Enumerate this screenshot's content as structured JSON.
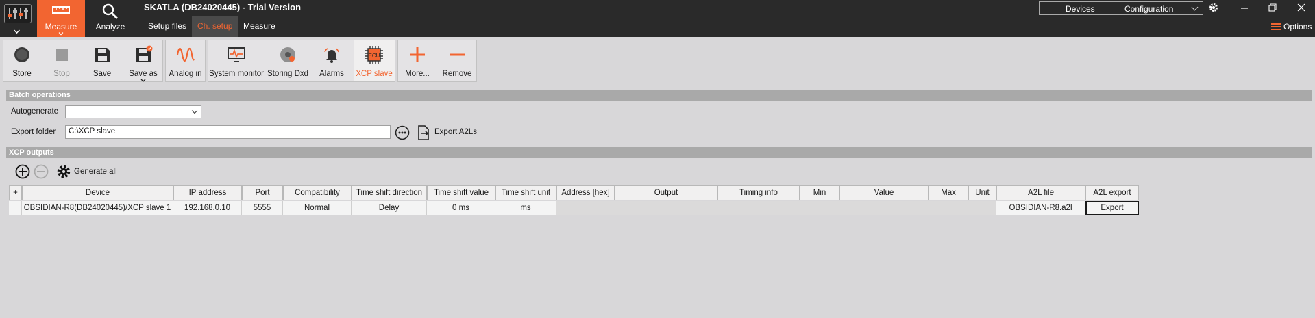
{
  "window": {
    "title": "SKATLA (DB24020445) - Trial Version"
  },
  "top_tabs": {
    "measure": "Measure",
    "analyze": "Analyze"
  },
  "sub_tabs": [
    "Setup files",
    "Ch. setup",
    "Measure"
  ],
  "devices_box": {
    "devices": "Devices",
    "configuration": "Configuration"
  },
  "options_label": "Options",
  "ribbon": {
    "store": "Store",
    "stop": "Stop",
    "save": "Save",
    "save_as": "Save as",
    "analog_in": "Analog in",
    "system_monitor": "System monitor",
    "storing_dxd": "Storing Dxd",
    "alarms": "Alarms",
    "xcp_slave": "XCP slave",
    "more": "More...",
    "remove": "Remove",
    "ecu_badge": "ECU"
  },
  "batch": {
    "header": "Batch operations",
    "autogenerate_label": "Autogenerate",
    "autogenerate_value": "",
    "export_folder_label": "Export folder",
    "export_folder_value": "C:\\XCP slave",
    "export_a2ls": "Export A2Ls"
  },
  "outputs": {
    "header": "XCP outputs",
    "generate_all": "Generate all",
    "columns": [
      "+",
      "Device",
      "IP address",
      "Port",
      "Compatibility",
      "Time shift direction",
      "Time shift value",
      "Time shift unit",
      "Address [hex]",
      "Output",
      "Timing info",
      "Min",
      "Value",
      "Max",
      "Unit",
      "A2L file",
      "A2L export"
    ],
    "rows": [
      {
        "device": "OBSIDIAN-R8(DB24020445)/XCP slave 1",
        "ip": "192.168.0.10",
        "port": "5555",
        "compatibility": "Normal",
        "ts_direction": "Delay",
        "ts_value": "0 ms",
        "ts_unit": "ms",
        "a2l_file": "OBSIDIAN-R8.a2l",
        "a2l_export": "Export"
      }
    ]
  },
  "colors": {
    "accent": "#f26531",
    "topbar": "#2a2a2a",
    "background": "#d8d7d9",
    "section_header": "#a9a9a9"
  }
}
